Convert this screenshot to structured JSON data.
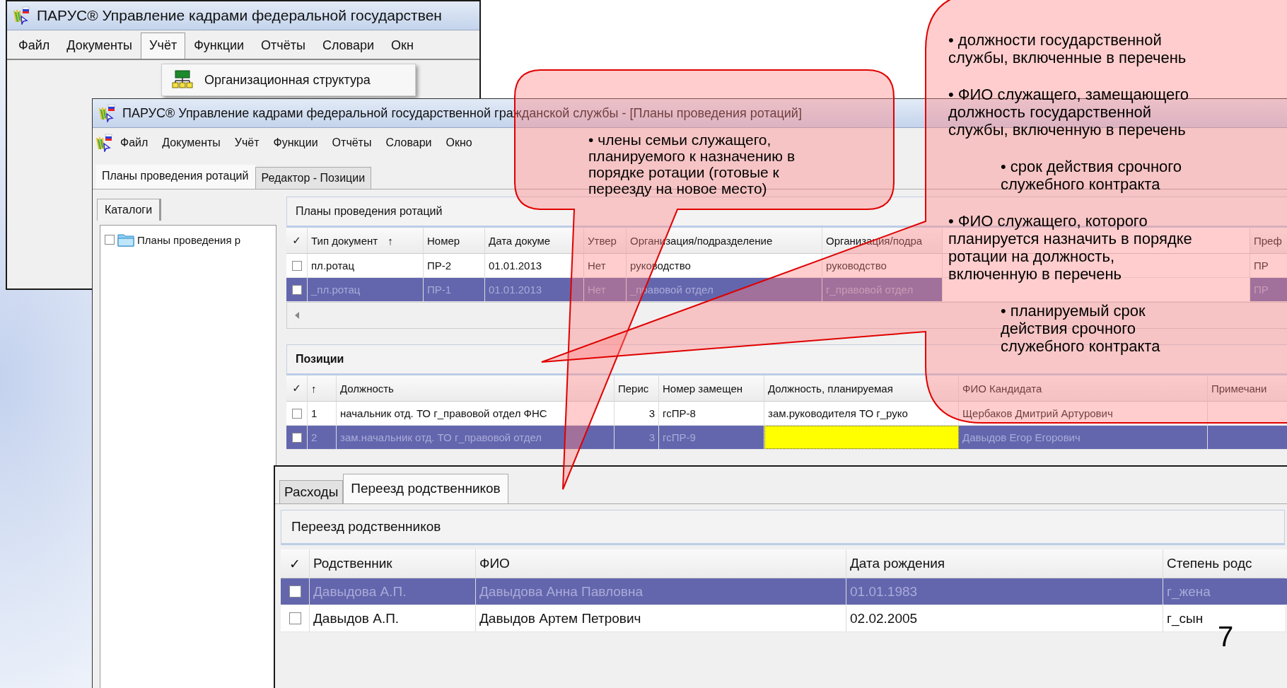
{
  "org_window": {
    "title": "ПАРУС® Управление кадрами федеральной государствен",
    "menu": [
      {
        "label": "Файл",
        "selected": false
      },
      {
        "label": "Документы",
        "selected": false
      },
      {
        "label": "Учёт",
        "selected": true
      },
      {
        "label": "Функции",
        "selected": false
      },
      {
        "label": "Отчёты",
        "selected": false
      },
      {
        "label": "Словари",
        "selected": false
      },
      {
        "label": "Окн",
        "selected": false
      }
    ],
    "menu_dropdown": [
      "Организационная структура"
    ]
  },
  "rotation_window": {
    "title": "ПАРУС® Управление кадрами федеральной государственной гражданской службы - [Планы проведения ротаций]",
    "menu": [
      "Файл",
      "Документы",
      "Учёт",
      "Функции",
      "Отчёты",
      "Словари",
      "Окно"
    ],
    "tabs": [
      {
        "label": "Планы проведения ротаций",
        "selected": true
      },
      {
        "label": "Редактор - Позиции",
        "selected": false
      }
    ],
    "catalog_tab": "Каталоги",
    "catalog_tree": [
      {
        "label": "Планы проведения р",
        "checked": false
      }
    ],
    "plans": {
      "title": "Планы проведения ротаций",
      "check_header": "✓",
      "columns": [
        {
          "label": "Тип документ",
          "sort": "↑"
        },
        {
          "label": "Номер"
        },
        {
          "label": "Дата докуме"
        },
        {
          "label": "Утвер"
        },
        {
          "label": "Организация/подразделение"
        },
        {
          "label": "Организация/подра"
        },
        {
          "label": "Преф"
        }
      ],
      "rows": [
        {
          "selected": false,
          "checked": false,
          "cells": [
            "пл.ротац",
            "ПР-2",
            "01.01.2013",
            "Нет",
            "руководство",
            "руководство",
            "ПР"
          ]
        },
        {
          "selected": true,
          "checked": false,
          "cells": [
            "_пл.ротац",
            "ПР-1",
            "01.01.2013",
            "Нет",
            "_правовой отдел",
            "г_правовой отдел",
            "ПР"
          ]
        }
      ]
    },
    "positions": {
      "title": "Позиции",
      "check_header": "✓",
      "columns": [
        {
          "label": "↑"
        },
        {
          "label": "Должность"
        },
        {
          "label": "Перис"
        },
        {
          "label": "Номер замещен"
        },
        {
          "label": "Должность, планируемая"
        },
        {
          "label": "ФИО Кандидата"
        },
        {
          "label": "Примечани"
        }
      ],
      "rows": [
        {
          "selected": false,
          "checked": false,
          "planned_focused": false,
          "cells": [
            "1",
            "начальник отд. ТО г_правовой отдел ФНС",
            "3",
            "гсПР-8",
            "зам.руководителя ТО г_руко",
            "Щербаков Дмитрий Артурович",
            null
          ]
        },
        {
          "selected": true,
          "checked": false,
          "planned_focused": true,
          "cells": [
            "2",
            "зам.начальник отд. ТО г_правовой отдел",
            "3",
            "гсПР-9",
            null,
            "Давыдов Егор Егорович",
            null
          ]
        }
      ]
    }
  },
  "relocation_window": {
    "tabs": [
      {
        "label": "Расходы",
        "selected": false
      },
      {
        "label": "Переезд родственников",
        "selected": true
      }
    ],
    "panel_title": "Переезд родственников",
    "check_header": "✓",
    "columns": [
      {
        "label": "Родственник"
      },
      {
        "label": "ФИО"
      },
      {
        "label": "Дата рождения"
      },
      {
        "label": "Степень родс"
      }
    ],
    "rows": [
      {
        "selected": true,
        "checked": false,
        "cells": [
          "Давыдова А.П.",
          "Давыдова Анна Павловна",
          "01.01.1983",
          "г_жена"
        ]
      },
      {
        "selected": false,
        "checked": false,
        "cells": [
          "Давыдов А.П.",
          "Давыдов Артем  Петрович",
          "02.02.2005",
          "г_сын"
        ]
      }
    ]
  },
  "callouts": [
    {
      "bullets": [
        {
          "text": "• члены семьи служащего, планируемого к назначению в порядке ротации (готовые к переезду на новое место)",
          "indented": false
        }
      ]
    },
    {
      "bullets": [
        {
          "text": "• должности государственной службы, включенные в перечень",
          "indented": false
        },
        {
          "text": "• ФИО служащего, замещающего должность государственной службы, включенную в перечень",
          "indented": false
        },
        {
          "text": "• срок действия срочного служебного контракта",
          "indented": true
        },
        {
          "text": "• ФИО служащего, которого планируется назначить в порядке ротации на должность, включенную в перечень",
          "indented": false
        },
        {
          "text": "• планируемый срок действия срочного служебного контракта",
          "indented": true
        }
      ]
    }
  ],
  "slide_number": "7"
}
